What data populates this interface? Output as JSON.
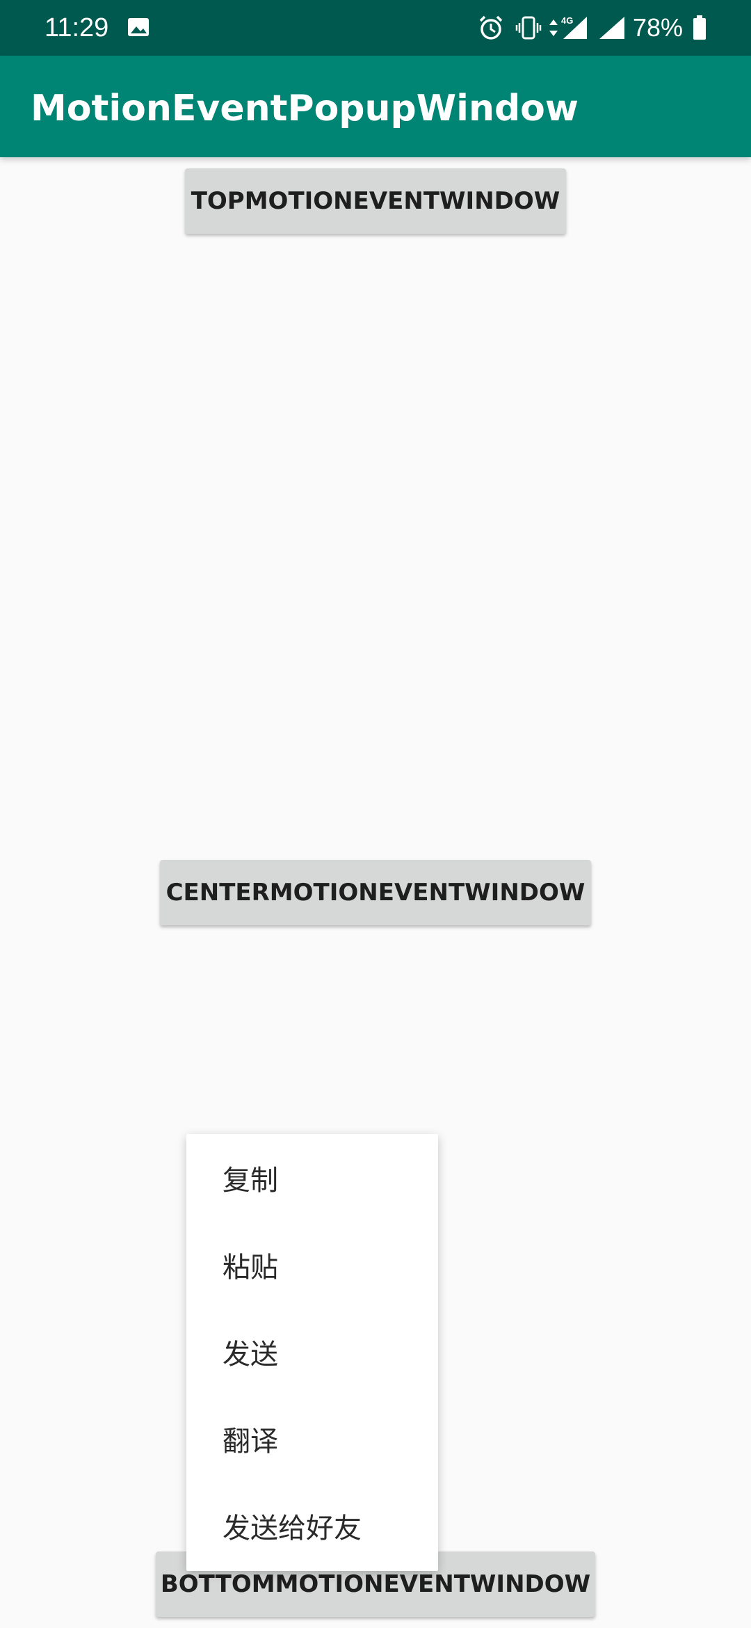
{
  "status_bar": {
    "time": "11:29",
    "battery": "78%",
    "icons": [
      "image-icon",
      "alarm-icon",
      "vibrate-icon",
      "data-arrows-icon",
      "signal-4g-icon",
      "signal-icon",
      "battery-icon"
    ],
    "network_label": "4G",
    "color": "#00594f"
  },
  "app_bar": {
    "title": "MotionEventPopupWindow",
    "color": "#008575"
  },
  "buttons": {
    "top": "TOPMOTIONEVENTWINDOW",
    "center": "CENTERMOTIONEVENTWINDOW",
    "bottom": "BOTTOMMOTIONEVENTWINDOW"
  },
  "popup_menu": {
    "items": [
      {
        "label": "复制"
      },
      {
        "label": "粘贴"
      },
      {
        "label": "发送"
      },
      {
        "label": "翻译"
      },
      {
        "label": "发送给好友"
      }
    ]
  }
}
